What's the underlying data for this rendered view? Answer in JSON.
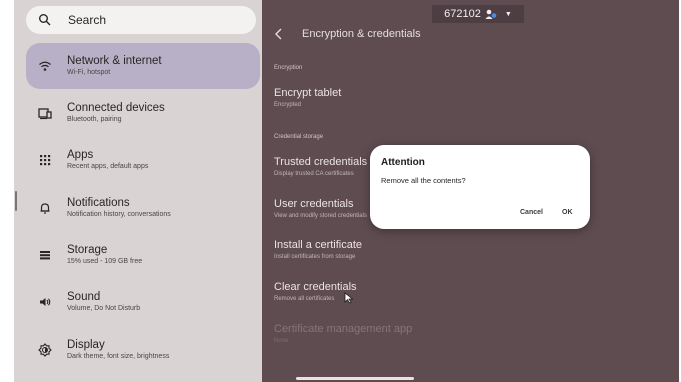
{
  "search": {
    "label": "Search",
    "icon": "search-icon"
  },
  "sidebar": {
    "items": [
      {
        "title": "Network & internet",
        "subtitle": "Wi-Fi, hotspot",
        "icon": "wifi-icon",
        "active": true
      },
      {
        "title": "Connected devices",
        "subtitle": "Bluetooth, pairing",
        "icon": "devices-icon",
        "active": false
      },
      {
        "title": "Apps",
        "subtitle": "Recent apps, default apps",
        "icon": "apps-grid-icon",
        "active": false
      },
      {
        "title": "Notifications",
        "subtitle": "Notification history, conversations",
        "icon": "bell-icon",
        "active": false
      },
      {
        "title": "Storage",
        "subtitle": "15% used - 109 GB free",
        "icon": "storage-icon",
        "active": false
      },
      {
        "title": "Sound",
        "subtitle": "Volume, Do Not Disturb",
        "icon": "speaker-icon",
        "active": false
      },
      {
        "title": "Display",
        "subtitle": "Dark theme, font size, brightness",
        "icon": "brightness-icon",
        "active": false
      }
    ]
  },
  "status": {
    "text": "672102",
    "icon": "user-profile-icon"
  },
  "header": {
    "title": "Encryption & credentials",
    "back_icon": "back-arrow-icon"
  },
  "content": {
    "sections": {
      "encryption": "Encryption",
      "credential_storage": "Credential storage"
    },
    "rows": [
      {
        "title": "Encrypt tablet",
        "subtitle": "Encrypted"
      },
      {
        "title": "Trusted credentials",
        "subtitle": "Display trusted CA certificates"
      },
      {
        "title": "User credentials",
        "subtitle": "View and modify stored credentials"
      },
      {
        "title": "Install a certificate",
        "subtitle": "Install certificates from storage"
      },
      {
        "title": "Clear credentials",
        "subtitle": "Remove all certificates"
      },
      {
        "title": "Certificate management app",
        "subtitle": "None"
      }
    ]
  },
  "dialog": {
    "title": "Attention",
    "message": "Remove all the contents?",
    "cancel_label": "Cancel",
    "ok_label": "OK"
  },
  "colors": {
    "sidebar_bg": "#d9d3d3",
    "active_item_bg": "#b8b0c6",
    "panel_dim_bg": "#5f4c51",
    "dialog_bg": "#ffffff"
  }
}
